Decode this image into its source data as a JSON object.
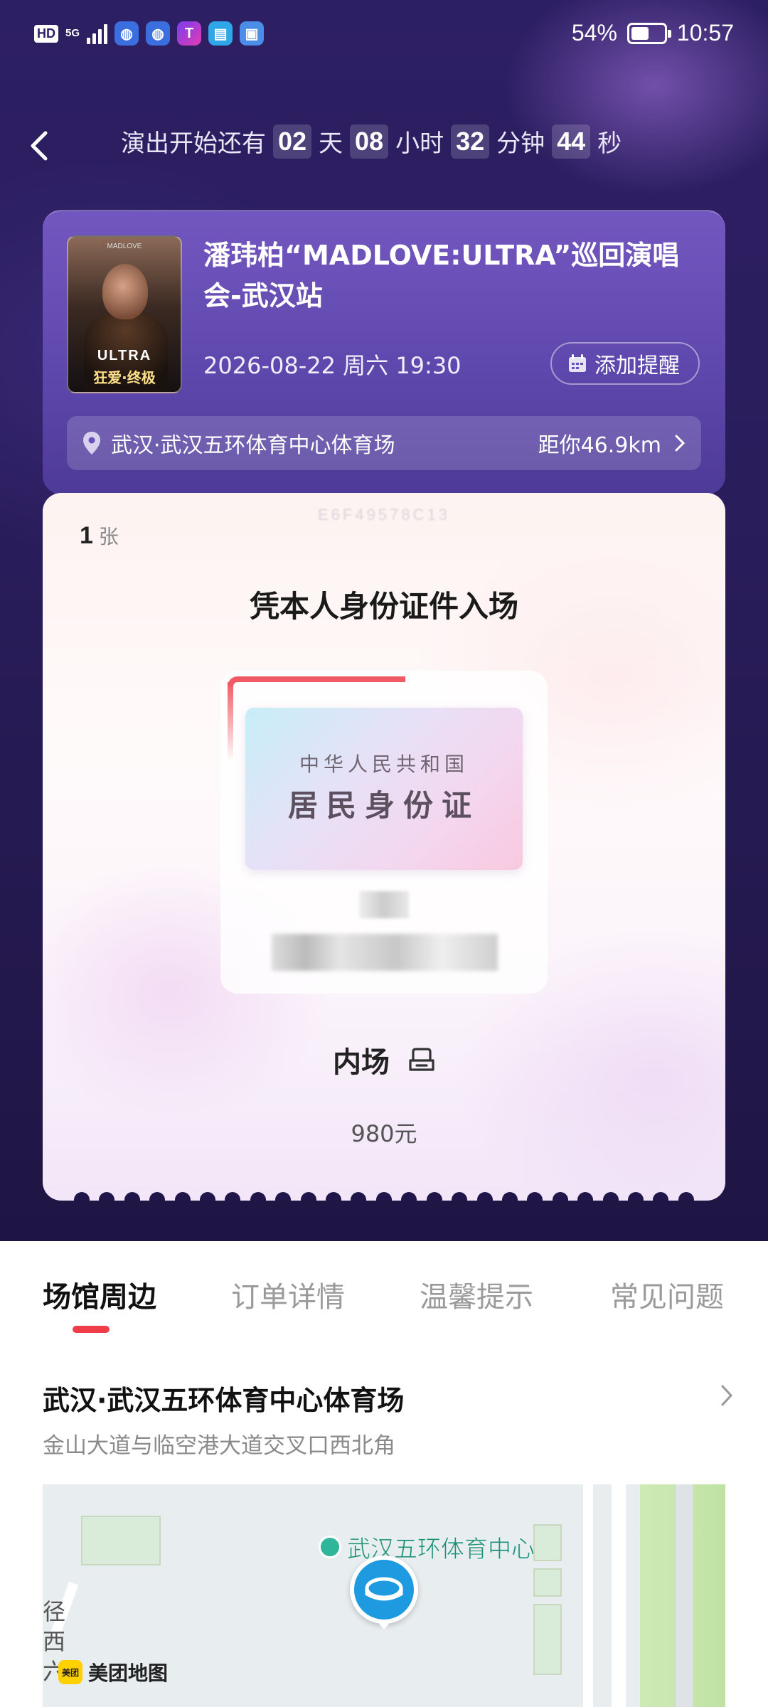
{
  "status_bar": {
    "hd": "HD",
    "network": "5G",
    "battery": "54%",
    "battery_level": 0.54,
    "time": "10:57",
    "app_icons": [
      "app-blue-icon",
      "app-blue-icon",
      "app-t-icon",
      "app-book-icon",
      "app-id-icon"
    ]
  },
  "countdown": {
    "prefix": "演出开始还有",
    "days": "02",
    "days_unit": "天",
    "hours": "08",
    "hours_unit": "小时",
    "minutes": "32",
    "minutes_unit": "分钟",
    "seconds": "44",
    "seconds_unit": "秒"
  },
  "event": {
    "title": "潘玮柏“MADLOVE:ULTRA”巡回演唱会-武汉站",
    "datetime": "2026-08-22 周六 19:30",
    "remind_label": "添加提醒",
    "venue": "武汉·武汉五环体育中心体育场",
    "distance": "距你46.9km",
    "poster": {
      "top": "MADLOVE",
      "logo": "ULTRA",
      "subtitle": "狂爱·终极"
    }
  },
  "ticket": {
    "code": "E6F49578C13",
    "count": "1",
    "count_unit": "张",
    "headline": "凭本人身份证件入场",
    "id_card_line1": "中华人民共和国",
    "id_card_line2": "居民身份证",
    "seat": "内场",
    "price": "980元"
  },
  "tabs": [
    {
      "label": "场馆周边",
      "active": true
    },
    {
      "label": "订单详情",
      "active": false
    },
    {
      "label": "温馨提示",
      "active": false
    },
    {
      "label": "常见问题",
      "active": false
    }
  ],
  "venue_section": {
    "name": "武汉·武汉五环体育中心体育场",
    "address": "金山大道与临空港大道交叉口西北角"
  },
  "map": {
    "poi_label": "武汉五环体育中心",
    "side_text": "径西六",
    "brand": "美团地图",
    "brand_logo": "美团"
  },
  "colors": {
    "accent": "#ef3e4a",
    "header_bg": "#2a1d5c",
    "card_bg": "#6a50b8"
  }
}
